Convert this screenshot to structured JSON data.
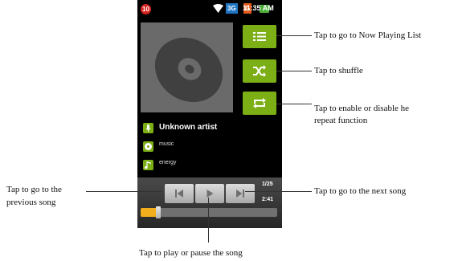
{
  "status_bar": {
    "notification_count": "10",
    "network_3g": "3G",
    "network_g": "G",
    "time": "11:35 AM"
  },
  "track": {
    "artist": "Unknown artist",
    "album": "music",
    "title": "energy",
    "position_text": "1/25",
    "duration_text": "2:41",
    "progress": 0.11
  },
  "colors": {
    "accent_green": "#7cae16",
    "progress_orange": "#f2ae1c"
  },
  "buttons": {
    "now_playing_list": "list-icon",
    "shuffle": "shuffle-icon",
    "repeat": "repeat-icon",
    "previous": "previous-icon",
    "play_pause": "play-icon",
    "next": "next-icon"
  },
  "callouts": {
    "now_playing": "Tap to go to Now Playing List",
    "shuffle": "Tap to shuffle",
    "repeat_line1": "Tap to enable or disable  he",
    "repeat_line2": "repeat function",
    "previous_line1": "Tap to go to the",
    "previous_line2": "previous song",
    "next": "Tap to go to the next song",
    "play_pause": "Tap to play or pause the song"
  }
}
